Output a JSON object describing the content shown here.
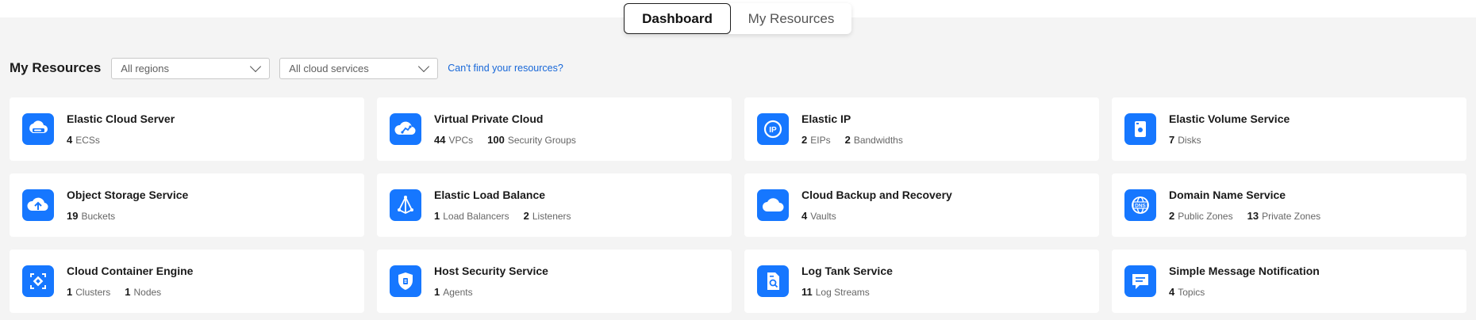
{
  "tabs": {
    "dashboard": "Dashboard",
    "my_resources": "My Resources"
  },
  "filters": {
    "title": "My Resources",
    "region_value": "All regions",
    "service_value": "All cloud services",
    "help_link": "Can't find your resources?"
  },
  "colors": {
    "accent": "#1677ff",
    "link": "#1767d8"
  },
  "cards": [
    {
      "name": "Elastic Cloud Server",
      "icon": "server-icon",
      "stats": [
        {
          "value": "4",
          "label": "ECSs"
        }
      ]
    },
    {
      "name": "Virtual Private Cloud",
      "icon": "vpc-cloud-icon",
      "stats": [
        {
          "value": "44",
          "label": "VPCs"
        },
        {
          "value": "100",
          "label": "Security Groups"
        }
      ]
    },
    {
      "name": "Elastic IP",
      "icon": "ip-icon",
      "stats": [
        {
          "value": "2",
          "label": "EIPs"
        },
        {
          "value": "2",
          "label": "Bandwidths"
        }
      ]
    },
    {
      "name": "Elastic Volume Service",
      "icon": "disk-icon",
      "stats": [
        {
          "value": "7",
          "label": "Disks"
        }
      ]
    },
    {
      "name": "Object Storage Service",
      "icon": "cloud-upload-icon",
      "stats": [
        {
          "value": "19",
          "label": "Buckets"
        }
      ]
    },
    {
      "name": "Elastic Load Balance",
      "icon": "load-balancer-icon",
      "stats": [
        {
          "value": "1",
          "label": "Load Balancers"
        },
        {
          "value": "2",
          "label": "Listeners"
        }
      ]
    },
    {
      "name": "Cloud Backup and Recovery",
      "icon": "backup-cloud-icon",
      "stats": [
        {
          "value": "4",
          "label": "Vaults"
        }
      ]
    },
    {
      "name": "Domain Name Service",
      "icon": "dns-globe-icon",
      "stats": [
        {
          "value": "2",
          "label": "Public Zones"
        },
        {
          "value": "13",
          "label": "Private Zones"
        }
      ]
    },
    {
      "name": "Cloud Container Engine",
      "icon": "container-icon",
      "stats": [
        {
          "value": "1",
          "label": "Clusters"
        },
        {
          "value": "1",
          "label": "Nodes"
        }
      ]
    },
    {
      "name": "Host Security Service",
      "icon": "shield-icon",
      "stats": [
        {
          "value": "1",
          "label": "Agents"
        }
      ]
    },
    {
      "name": "Log Tank Service",
      "icon": "log-document-icon",
      "stats": [
        {
          "value": "11",
          "label": "Log Streams"
        }
      ]
    },
    {
      "name": "Simple Message Notification",
      "icon": "message-icon",
      "stats": [
        {
          "value": "4",
          "label": "Topics"
        }
      ]
    }
  ]
}
